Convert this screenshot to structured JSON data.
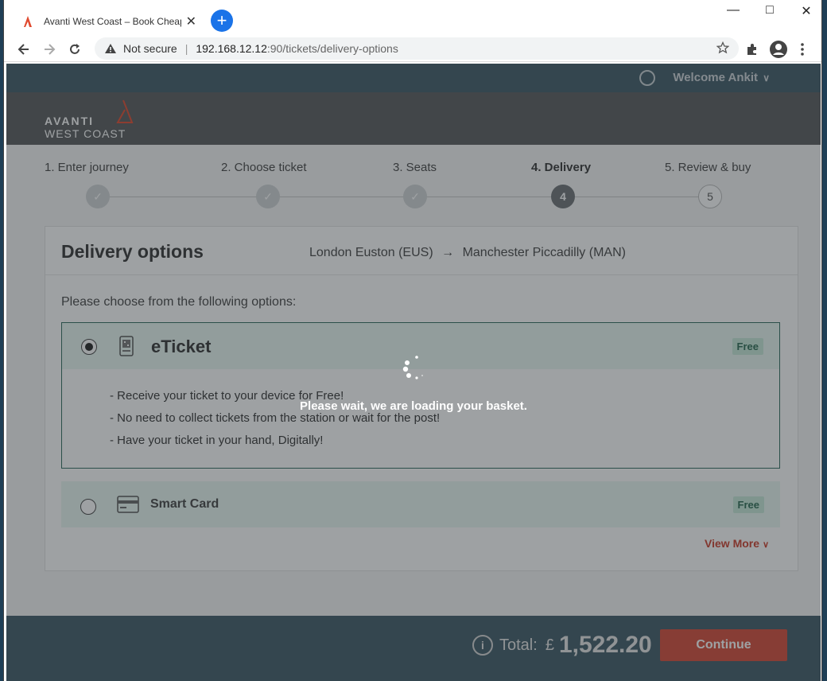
{
  "browser": {
    "tab_title": "Avanti West Coast – Book Cheap",
    "tab_close": "✕",
    "new_tab": "+",
    "security_label": "Not secure",
    "url_host": "192.168.12.12",
    "url_path": ":90/tickets/delivery-options",
    "window_controls": {
      "minimize": "—",
      "maximize": "□",
      "close": "✕"
    }
  },
  "header": {
    "welcome": "Welcome Ankit",
    "welcome_chevron": "∨",
    "logo_line1": "AVANTI",
    "logo_line2": "WEST COAST"
  },
  "steps": [
    {
      "label": "1. Enter journey",
      "marker": "✓",
      "status": "done"
    },
    {
      "label": "2. Choose ticket",
      "marker": "✓",
      "status": "done"
    },
    {
      "label": "3. Seats",
      "marker": "✓",
      "status": "done"
    },
    {
      "label": "4. Delivery",
      "marker": "4",
      "status": "current"
    },
    {
      "label": "5. Review & buy",
      "marker": "5",
      "status": "future"
    }
  ],
  "delivery": {
    "title": "Delivery options",
    "origin": "London Euston (EUS)",
    "route_arrow": "→",
    "destination": "Manchester Piccadilly (MAN)",
    "prompt": "Please choose from the following options:",
    "options": [
      {
        "name": "eTicket",
        "price": "Free",
        "selected": true,
        "bullets": [
          "- Receive your ticket to your device for Free!",
          "- No need to collect tickets from the station or wait for the post!",
          "- Have your ticket in your hand, Digitally!"
        ]
      },
      {
        "name": "Smart Card",
        "price": "Free",
        "selected": false
      }
    ],
    "view_more": "View More"
  },
  "footer": {
    "total_label": "Total:",
    "currency": "£",
    "total_amount": "1,522.20",
    "info_icon": "i",
    "continue_label": "Continue"
  },
  "loading": {
    "message": "Please wait, we are loading your basket."
  },
  "colors": {
    "accent": "#d64a37",
    "header_bar": "#3f5a66",
    "brand_bar": "#585a5b",
    "option_highlight": "#e9f7f3",
    "free_badge": "#c6ead9"
  }
}
